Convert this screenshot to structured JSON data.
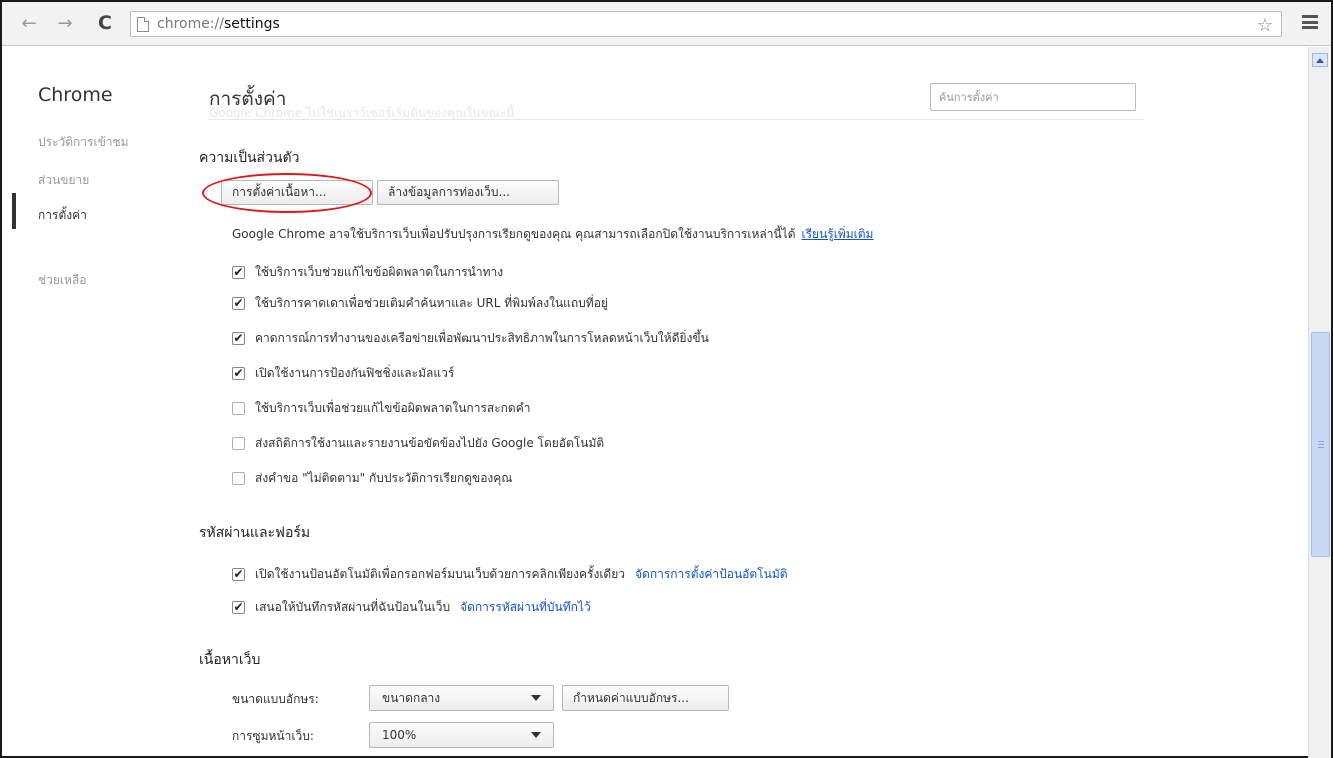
{
  "toolbar": {
    "back_glyph": "←",
    "forward_glyph": "→",
    "reload_glyph": "C",
    "url_scheme": "chrome://",
    "url_path": "settings",
    "star_glyph": "☆"
  },
  "sidebar": {
    "brand": "Chrome",
    "items": [
      {
        "label": "ประวัติการเข้าชม"
      },
      {
        "label": "ส่วนขยาย"
      },
      {
        "label": "การตั้งค่า"
      },
      {
        "label": "ช่วยเหลือ"
      }
    ]
  },
  "header": {
    "title": "การตั้งค่า",
    "default_browser_note": "Google Chrome ไม่ใช่เบราว์เซอร์เริ่มต้นของคุณในขณะนี้",
    "search_placeholder": "ค้นการตั้งค่า"
  },
  "privacy": {
    "title": "ความเป็นส่วนตัว",
    "content_settings_button": "การตั้งค่าเนื้อหา...",
    "clear_data_button": "ล้างข้อมูลการท่องเว็บ...",
    "description": "Google Chrome อาจใช้บริการเว็บเพื่อปรับปรุงการเรียกดูของคุณ คุณสามารถเลือกปิดใช้งานบริการเหล่านี้ได้",
    "learn_more": "เรียนรู้เพิ่มเติม",
    "options": [
      {
        "label": "ใช้บริการเว็บช่วยแก้ไขข้อผิดพลาดในการนำทาง",
        "mark": "✔"
      },
      {
        "label": "ใช้บริการคาดเดาเพื่อช่วยเติมคำค้นหาและ URL ที่พิมพ์ลงในแถบที่อยู่",
        "mark": "✔"
      },
      {
        "label": "คาดการณ์การทำงานของเครือข่ายเพื่อพัฒนาประสิทธิภาพในการโหลดหน้าเว็บให้ดียิ่งขึ้น",
        "mark": "✔"
      },
      {
        "label": "เปิดใช้งานการป้องกันฟิชชิ่งและมัลแวร์",
        "mark": "✔"
      },
      {
        "label": "ใช้บริการเว็บเพื่อช่วยแก้ไขข้อผิดพลาดในการสะกดคำ",
        "mark": ""
      },
      {
        "label": "ส่งสถิติการใช้งานและรายงานข้อขัดข้องไปยัง Google โดยอัตโนมัติ",
        "mark": ""
      },
      {
        "label": "ส่งคำขอ \"ไม่ติดตาม\" กับประวัติการเรียกดูของคุณ",
        "mark": ""
      }
    ]
  },
  "passwords": {
    "title": "รหัสผ่านและฟอร์ม",
    "options": [
      {
        "label": "เปิดใช้งานป้อนอัตโนมัติเพื่อกรอกฟอร์มบนเว็บด้วยการคลิกเพียงครั้งเดียว",
        "mark": "✔",
        "link": "จัดการการตั้งค่าป้อนอัตโนมัติ"
      },
      {
        "label": "เสนอให้บันทึกรหัสผ่านที่ฉันป้อนในเว็บ",
        "mark": "✔",
        "link": "จัดการรหัสผ่านที่บันทึกไว้"
      }
    ]
  },
  "web_content": {
    "title": "เนื้อหาเว็บ",
    "font_size_label": "ขนาดแบบอักษร:",
    "font_size_value": "ขนาดกลาง",
    "customize_fonts_button": "กำหนดค่าแบบอักษร...",
    "zoom_label": "การซูมหน้าเว็บ:",
    "zoom_value": "100%"
  },
  "colors": {
    "link": "#1155cc",
    "annotation_oval": "#e01818",
    "scroll_thumb": "#c9d9f5"
  }
}
